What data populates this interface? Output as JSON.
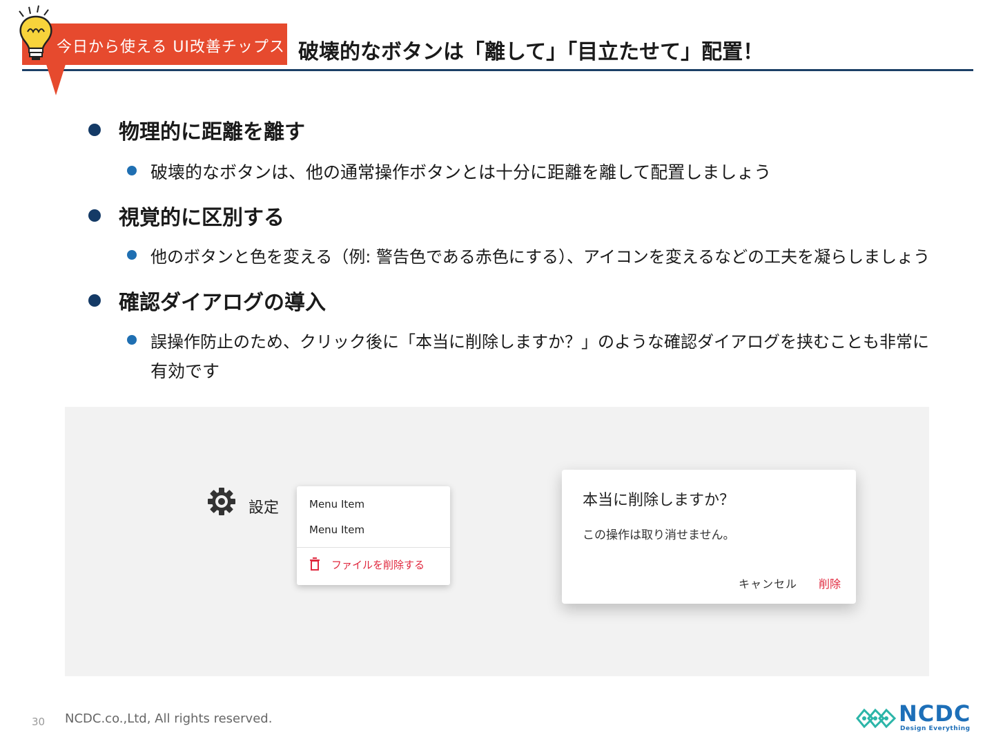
{
  "header": {
    "tag_label": "今日から使える UI改善チップス",
    "title": "破壊的なボタンは「離して」「目立たせて」配置！"
  },
  "bullets": [
    {
      "heading": "物理的に距離を離す",
      "details": [
        "破壊的なボタンは、他の通常操作ボタンとは十分に距離を離して配置しましょう"
      ]
    },
    {
      "heading": "視覚的に区別する",
      "details": [
        "他のボタンと色を変える（例: 警告色である赤色にする）、アイコンを変えるなどの工夫を凝らしましょう"
      ]
    },
    {
      "heading": "確認ダイアログの導入",
      "details": [
        "誤操作防止のため、クリック後に「本当に削除しますか？」のような確認ダイアログを挟むことも非常に",
        "有効です"
      ]
    }
  ],
  "demo": {
    "settings_label": "設定",
    "menu_items": [
      "Menu Item",
      "Menu Item"
    ],
    "danger_item": "ファイルを削除する",
    "dialog": {
      "title": "本当に削除しますか？",
      "body": "この操作は取り消せません。",
      "cancel": "キャンセル",
      "delete": "削除"
    }
  },
  "footer": {
    "page_number": "30",
    "copyright": "NCDC.co.,Ltd, All rights reserved.",
    "logo_text": "NCDC",
    "logo_tagline": "Design Everything"
  },
  "colors": {
    "tag": "#e64a2e",
    "rule": "#1b3f66",
    "bullet_l1": "#143a66",
    "bullet_l2": "#1f6fb2",
    "danger": "#e0283e",
    "logo": "#1d6fb8"
  },
  "icons": [
    "lightbulb-icon",
    "gear-icon",
    "trash-icon",
    "ncdc-logo-mark"
  ]
}
